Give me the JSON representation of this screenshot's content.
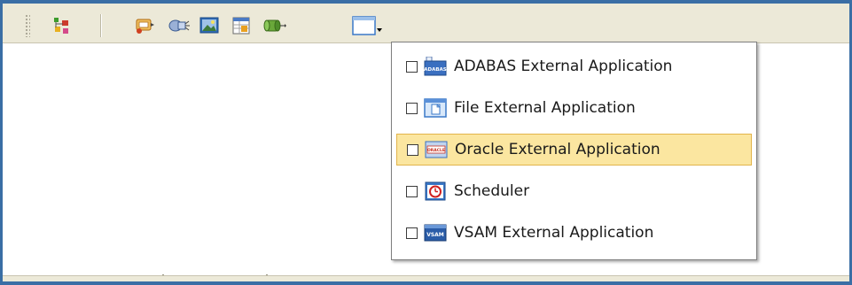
{
  "toolbar": {
    "buttons": [
      {
        "icon": "deploy-tree-icon"
      },
      {
        "icon": "service-icon"
      },
      {
        "icon": "connector-icon"
      },
      {
        "icon": "image-icon"
      },
      {
        "icon": "table-icon"
      },
      {
        "icon": "pipe-arrow-icon"
      },
      {
        "icon": "window-dropdown-icon"
      }
    ]
  },
  "menu": {
    "items": [
      {
        "label": "ADABAS External Application",
        "icon": "adabas-icon",
        "checked": false,
        "highlighted": false,
        "icon_text": "ADABAS"
      },
      {
        "label": "File External Application",
        "icon": "file-icon",
        "checked": false,
        "highlighted": false,
        "icon_text": ""
      },
      {
        "label": "Oracle External Application",
        "icon": "oracle-icon",
        "checked": false,
        "highlighted": true,
        "icon_text": "ORACLE"
      },
      {
        "label": "Scheduler",
        "icon": "scheduler-icon",
        "checked": false,
        "highlighted": false,
        "icon_text": ""
      },
      {
        "label": "VSAM External Application",
        "icon": "vsam-icon",
        "checked": false,
        "highlighted": false,
        "icon_text": "VSAM"
      }
    ]
  },
  "colors": {
    "frame": "#3a6ea5",
    "toolbar_bg": "#ece9d8",
    "highlight_bg": "#fbe6a0",
    "highlight_border": "#e2b44b"
  }
}
